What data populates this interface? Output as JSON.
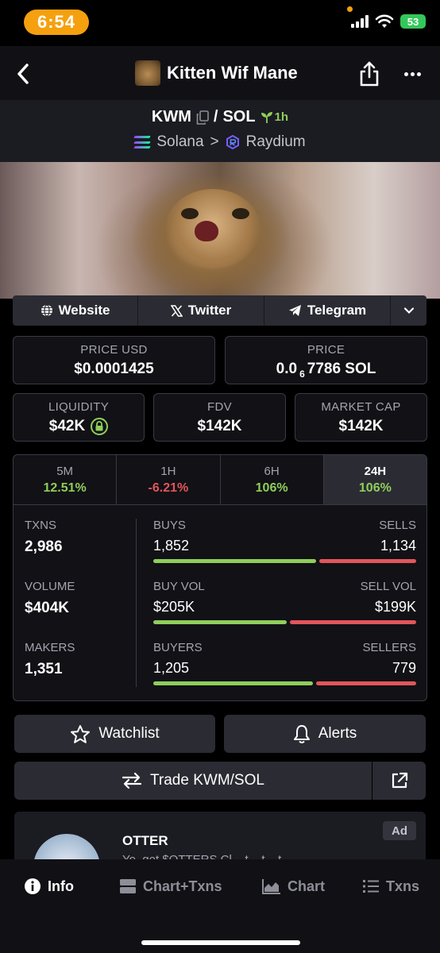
{
  "status_bar": {
    "time": "6:54",
    "battery": "53"
  },
  "header": {
    "title": "Kitten Wif Mane"
  },
  "pair": {
    "base": "KWM",
    "separator": "/",
    "quote": "SOL",
    "age": "1h",
    "chain": "Solana",
    "chevron": ">",
    "dex": "Raydium"
  },
  "links": {
    "website": "Website",
    "twitter": "Twitter",
    "telegram": "Telegram"
  },
  "prices": {
    "usd_label": "PRICE USD",
    "usd_value": "$0.0001425",
    "native_label": "PRICE",
    "native_prefix": "0.0",
    "native_zeros": "6",
    "native_digits": "7786 SOL"
  },
  "metrics": {
    "liquidity_label": "LIQUIDITY",
    "liquidity_value": "$42K",
    "fdv_label": "FDV",
    "fdv_value": "$142K",
    "mcap_label": "MARKET CAP",
    "mcap_value": "$142K"
  },
  "timeframes": [
    {
      "label": "5M",
      "value": "12.51%",
      "trend": "up"
    },
    {
      "label": "1H",
      "value": "-6.21%",
      "trend": "down"
    },
    {
      "label": "6H",
      "value": "106%",
      "trend": "up"
    },
    {
      "label": "24H",
      "value": "106%",
      "trend": "up",
      "active": true
    }
  ],
  "txn_stats": {
    "txns_label": "TXNS",
    "txns_value": "2,986",
    "volume_label": "VOLUME",
    "volume_value": "$404K",
    "makers_label": "MAKERS",
    "makers_value": "1,351",
    "buys_label": "BUYS",
    "buys_value": "1,852",
    "sells_label": "SELLS",
    "sells_value": "1,134",
    "buy_vol_label": "BUY VOL",
    "buy_vol_value": "$205K",
    "sell_vol_label": "SELL VOL",
    "sell_vol_value": "$199K",
    "buyers_label": "BUYERS",
    "buyers_value": "1,205",
    "sellers_label": "SELLERS",
    "sellers_value": "779",
    "buy_share_txns": 0.62,
    "buy_share_vol": 0.507,
    "buy_share_makers": 0.607
  },
  "actions": {
    "watchlist": "Watchlist",
    "alerts": "Alerts",
    "trade": "Trade KWM/SOL"
  },
  "ad": {
    "title": "OTTER",
    "badge": "Ad",
    "desc": "Yo, get $OTTERS Cl... t... t... t..."
  },
  "bottom_nav": {
    "info": "Info",
    "chart_txns": "Chart+Txns",
    "chart": "Chart",
    "txns": "Txns"
  },
  "colors": {
    "positive": "#8fce5a",
    "negative": "#e2555a",
    "time_pill": "#f5a00f",
    "battery": "#34c759"
  }
}
